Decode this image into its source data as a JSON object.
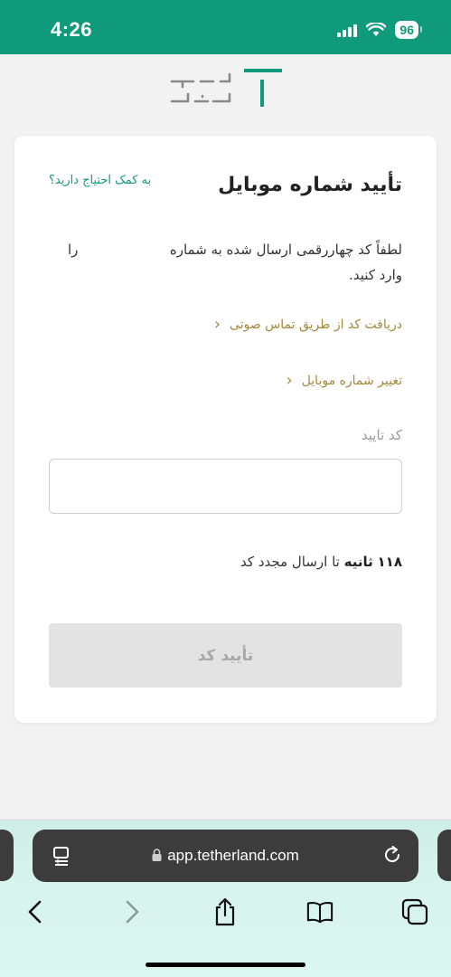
{
  "status_bar": {
    "time": "4:26",
    "battery": "96",
    "background_color": "#0f9a7b"
  },
  "card": {
    "title": "تأیید شماره موبایل",
    "help_link": "به کمک احتیاج دارید؟",
    "description_line1": "لطفاً کد چهاررقمی ارسال شده به شماره",
    "description_ra": "را",
    "description_line2": "وارد کنید.",
    "voice_call_link": "دریافت کد از طریق تماس صوتی",
    "change_number_link": "تغییر شماره موبایل",
    "code_label": "کد تایید",
    "code_value": "",
    "timer_value": "۱۱۸",
    "timer_unit": "ثانیه",
    "timer_suffix": "تا ارسال مجدد کد",
    "confirm_button": "تأیید کد"
  },
  "browser": {
    "url": "app.tetherland.com"
  },
  "colors": {
    "accent": "#0f9a7b",
    "link_gold": "#a3893c",
    "disabled_button": "#e3e3e3"
  },
  "icons": {
    "logo": "tetherland-logo",
    "reader": "reader-mode-icon",
    "lock": "lock-icon",
    "reload": "reload-icon",
    "back": "chevron-left-icon",
    "forward": "chevron-right-icon",
    "share": "share-icon",
    "bookmarks": "book-icon",
    "tabs": "tabs-icon"
  }
}
